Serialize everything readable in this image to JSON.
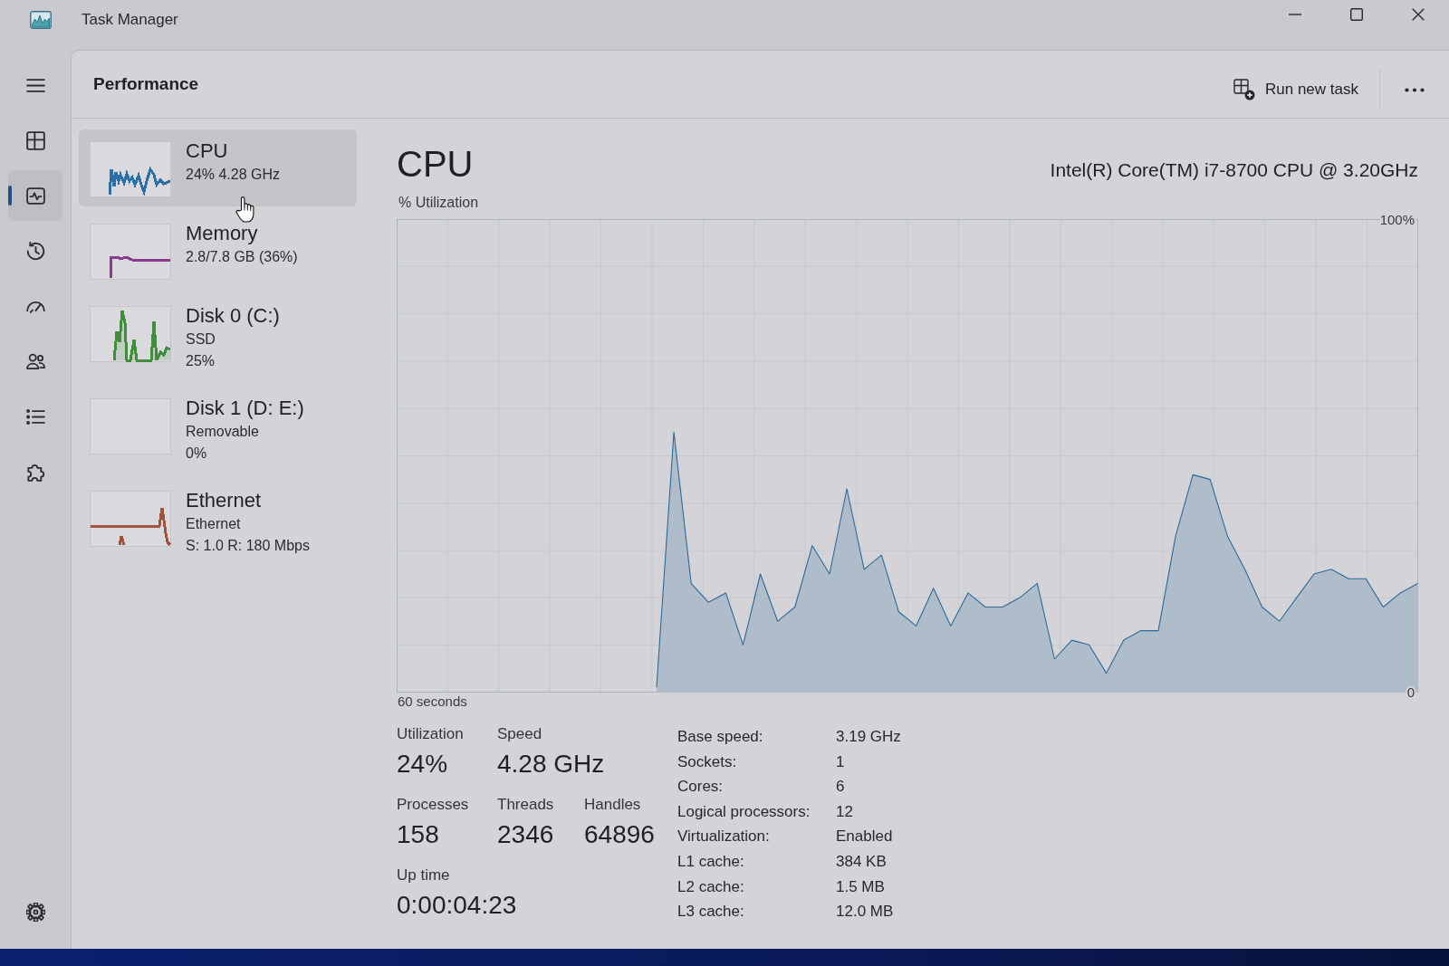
{
  "window": {
    "title": "Task Manager"
  },
  "navigation": [
    {
      "selected": false
    },
    {
      "selected": true
    },
    {
      "selected": false
    },
    {
      "selected": false
    },
    {
      "selected": false
    },
    {
      "selected": false
    },
    {
      "selected": false
    }
  ],
  "header": {
    "title": "Performance",
    "run_task_label": "Run new task"
  },
  "devices": [
    {
      "name": "CPU",
      "details": [
        "24% 4.28 GHz"
      ],
      "color": "#2a6fa8",
      "selected": true
    },
    {
      "name": "Memory",
      "details": [
        "2.8/7.8 GB (36%)"
      ],
      "color": "#8b3a8f",
      "selected": false
    },
    {
      "name": "Disk 0 (C:)",
      "details": [
        "SSD",
        "25%"
      ],
      "color": "#3f8f3a",
      "selected": false
    },
    {
      "name": "Disk 1 (D: E:)",
      "details": [
        "Removable",
        "0%"
      ],
      "selected": false
    },
    {
      "name": "Ethernet",
      "details": [
        "Ethernet",
        "S: 1.0 R: 180 Mbps"
      ],
      "color": "#a4533a",
      "selected": false
    }
  ],
  "detail": {
    "title": "CPU",
    "processor": "Intel(R) Core(TM) i7-8700 CPU @ 3.20GHz",
    "chart_data": {
      "type": "area",
      "xlabel": "60 seconds",
      "ylabel": "% Utilization",
      "grid": true,
      "categories": [
        null,
        null,
        null,
        null,
        null,
        null,
        null,
        null,
        null,
        null,
        null,
        null,
        null,
        null,
        null,
        null,
        null,
        null,
        null,
        null,
        null,
        null,
        null,
        null,
        null,
        null,
        null,
        null,
        null,
        null,
        null,
        null,
        null,
        null,
        null,
        null,
        null,
        null,
        null,
        null,
        null,
        null,
        null,
        null,
        null,
        null,
        null,
        null,
        null,
        null,
        null,
        null,
        null,
        null,
        null,
        null,
        null,
        null,
        null,
        null
      ],
      "series": [
        {
          "color": "#2b6a9a",
          "values": [
            null,
            null,
            null,
            null,
            null,
            null,
            null,
            null,
            null,
            null,
            null,
            null,
            null,
            null,
            null,
            1,
            55,
            23,
            19,
            21,
            10,
            25,
            15,
            18,
            31,
            25,
            43,
            26,
            29,
            17,
            14,
            22,
            14,
            21,
            18,
            18,
            20,
            23,
            7,
            11,
            10,
            4,
            11,
            13,
            13,
            33,
            46,
            45,
            33,
            26,
            18,
            15,
            20,
            25,
            26,
            24,
            24,
            18,
            21,
            23
          ]
        }
      ],
      "ylim": [
        0,
        100
      ],
      "yticks": [
        {
          "value": 100,
          "label": "100%"
        },
        {
          "value": 0,
          "label": "0"
        }
      ]
    },
    "stats": [
      [
        {
          "label": "Utilization",
          "value": "24%"
        },
        {
          "label": "Speed",
          "value": "4.28 GHz"
        }
      ],
      [
        {
          "label": "Processes",
          "value": "158"
        },
        {
          "label": "Threads",
          "value": "2346"
        },
        {
          "label": "Handles",
          "value": "64896"
        }
      ],
      [
        {
          "label": "Up time",
          "value": "0:00:04:23"
        }
      ]
    ],
    "specs": [
      {
        "label": "Base speed:",
        "value": "3.19 GHz"
      },
      {
        "label": "Sockets:",
        "value": "1"
      },
      {
        "label": "Cores:",
        "value": "6"
      },
      {
        "label": "Logical processors:",
        "value": "12"
      },
      {
        "label": "Virtualization:",
        "value": "Enabled"
      },
      {
        "label": "L1 cache:",
        "value": "384 KB"
      },
      {
        "label": "L2 cache:",
        "value": "1.5 MB"
      },
      {
        "label": "L3 cache:",
        "value": "12.0 MB"
      }
    ]
  }
}
